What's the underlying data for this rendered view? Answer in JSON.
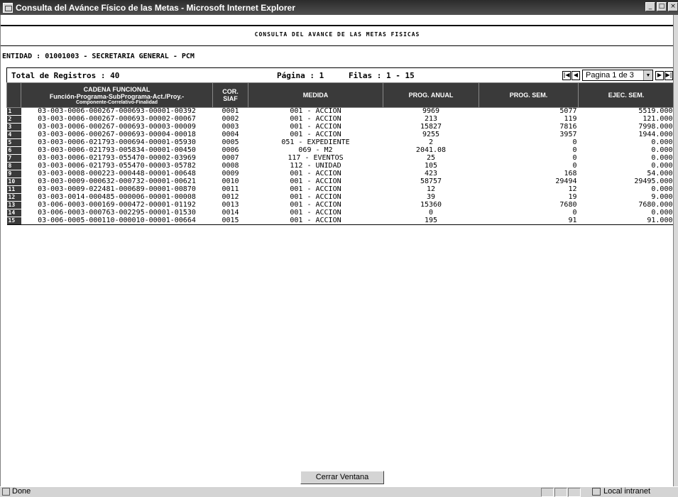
{
  "window": {
    "title": "Consulta del Avánce Físico de las Metas - Microsoft Internet Explorer",
    "minimize": "_",
    "maximize": "□",
    "close": "×"
  },
  "report": {
    "title": "CONSULTA DEL AVANCE DE LAS METAS FISICAS",
    "entity": "ENTIDAD : 01001003 - SECRETARIA GENERAL - PCM"
  },
  "summary": {
    "total": "Total de Registros : 40",
    "pagina": "Página : 1",
    "filas": "Filas : 1 - 15",
    "page_select": "Pagina 1 de 3"
  },
  "table": {
    "headers": {
      "cadena_l1": "CADENA FUNCIONAL",
      "cadena_l2": "Función-Programa-SubPrograma-Act./Proy.-",
      "cadena_l3": "Componente-Correlativo-Finalidad",
      "cor_l1": "COR.",
      "cor_l2": "SIAF",
      "medida": "MEDIDA",
      "prog_anual": "PROG. ANUAL",
      "prog_sem": "PROG. SEM.",
      "ejec_sem": "EJEC. SEM."
    },
    "rows": [
      {
        "n": "1",
        "cadena": "03-003-0006-000267-000693-00001-00392",
        "cor": "0001",
        "medida": "001 - ACCION",
        "anual": "9969",
        "sem": "5077",
        "ejec": "5519.000"
      },
      {
        "n": "2",
        "cadena": "03-003-0006-000267-000693-00002-00067",
        "cor": "0002",
        "medida": "001 - ACCION",
        "anual": "213",
        "sem": "119",
        "ejec": "121.000"
      },
      {
        "n": "3",
        "cadena": "03-003-0006-000267-000693-00003-00009",
        "cor": "0003",
        "medida": "001 - ACCION",
        "anual": "15827",
        "sem": "7816",
        "ejec": "7998.000"
      },
      {
        "n": "4",
        "cadena": "03-003-0006-000267-000693-00004-00018",
        "cor": "0004",
        "medida": "001 - ACCION",
        "anual": "9255",
        "sem": "3957",
        "ejec": "1944.000"
      },
      {
        "n": "5",
        "cadena": "03-003-0006-021793-000694-00001-05930",
        "cor": "0005",
        "medida": "051 - EXPEDIENTE",
        "anual": "2",
        "sem": "0",
        "ejec": "0.000"
      },
      {
        "n": "6",
        "cadena": "03-003-0006-021793-005834-00001-00450",
        "cor": "0006",
        "medida": "069 - M2",
        "anual": "2041.08",
        "sem": "0",
        "ejec": "0.000"
      },
      {
        "n": "7",
        "cadena": "03-003-0006-021793-055470-00002-03969",
        "cor": "0007",
        "medida": "117 - EVENTOS",
        "anual": "25",
        "sem": "0",
        "ejec": "0.000"
      },
      {
        "n": "8",
        "cadena": "03-003-0006-021793-055470-00003-05782",
        "cor": "0008",
        "medida": "112 - UNIDAD",
        "anual": "105",
        "sem": "0",
        "ejec": "0.000"
      },
      {
        "n": "9",
        "cadena": "03-003-0008-000223-000448-00001-00648",
        "cor": "0009",
        "medida": "001 - ACCION",
        "anual": "423",
        "sem": "168",
        "ejec": "54.000"
      },
      {
        "n": "10",
        "cadena": "03-003-0009-000632-000732-00001-00621",
        "cor": "0010",
        "medida": "001 - ACCION",
        "anual": "58757",
        "sem": "29494",
        "ejec": "29495.000"
      },
      {
        "n": "11",
        "cadena": "03-003-0009-022481-000689-00001-00870",
        "cor": "0011",
        "medida": "001 - ACCION",
        "anual": "12",
        "sem": "12",
        "ejec": "0.000"
      },
      {
        "n": "12",
        "cadena": "03-003-0014-000485-000006-00001-00008",
        "cor": "0012",
        "medida": "001 - ACCION",
        "anual": "39",
        "sem": "19",
        "ejec": "9.000"
      },
      {
        "n": "13",
        "cadena": "03-006-0003-000169-000472-00001-01192",
        "cor": "0013",
        "medida": "001 - ACCION",
        "anual": "15360",
        "sem": "7680",
        "ejec": "7680.000"
      },
      {
        "n": "14",
        "cadena": "03-006-0003-000763-002295-00001-01530",
        "cor": "0014",
        "medida": "001 - ACCION",
        "anual": "0",
        "sem": "0",
        "ejec": "0.000"
      },
      {
        "n": "15",
        "cadena": "03-006-0005-000110-000010-00001-00664",
        "cor": "0015",
        "medida": "001 - ACCION",
        "anual": "195",
        "sem": "91",
        "ejec": "91.000"
      }
    ]
  },
  "close_button": "Cerrar Ventana",
  "status": {
    "text": "Done",
    "zone": "Local intranet"
  }
}
